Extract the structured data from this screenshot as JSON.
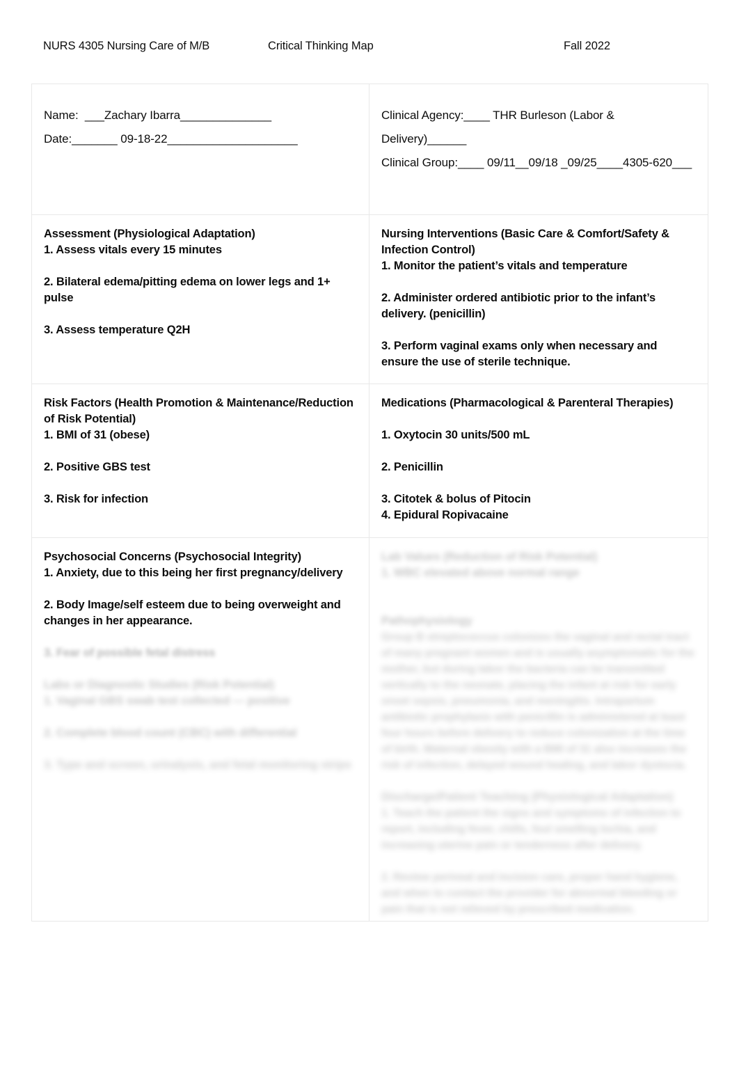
{
  "document": {
    "header": {
      "course": "NURS 4305 Nursing Care of M/B",
      "title": "Critical Thinking Map",
      "term": "Fall 2022"
    }
  },
  "identity": {
    "name_line": "Name:  ___Zachary Ibarra______________",
    "date_line": "Date:_______ 09-18-22____________________",
    "clinical_agency_line": "Clinical Agency:____ THR Burleson (Labor & Delivery)______",
    "clinical_group_line": "Clinical Group:____ 09/11__09/18 _09/25____4305-620___"
  },
  "sections": {
    "assessment": {
      "heading": "Assessment (Physiological Adaptation)",
      "items": [
        "1. Assess vitals every 15 minutes",
        "2. Bilateral edema/pitting edema on lower legs and 1+ pulse",
        "3. Assess temperature Q2H"
      ]
    },
    "nursing_interventions": {
      "heading": "Nursing Interventions (Basic Care & Comfort/Safety & Infection Control)",
      "items": [
        "1. Monitor the patient’s vitals and temperature",
        "2. Administer ordered antibiotic prior to the infant’s delivery. (penicillin)",
        "3. Perform vaginal exams only when necessary and ensure the use of sterile technique."
      ]
    },
    "risk_factors": {
      "heading": "Risk Factors (Health Promotion & Maintenance/Reduction of Risk Potential)",
      "items": [
        "1. BMI of 31 (obese)",
        "2. Positive GBS test",
        "3. Risk for infection"
      ]
    },
    "medications": {
      "heading": "Medications (Pharmacological & Parenteral Therapies)",
      "items": [
        "1. Oxytocin 30 units/500 mL",
        "2. Penicillin",
        "3. Citotek & bolus of Pitocin",
        "4. Epidural Ropivacaine"
      ]
    },
    "psychosocial": {
      "heading": "Psychosocial Concerns (Psychosocial Integrity)",
      "items": [
        "1. Anxiety, due to this being her first pregnancy/delivery",
        "2. Body Image/self esteem due to being overweight and changes in her appearance.",
        "3. Fear of possible fetal distress"
      ]
    },
    "labs_diagnostics": {
      "heading": "Labs or Diagnostic Studies (Risk Potential)",
      "items": [
        "1. Vaginal GBS swab test collected — positive",
        "2. Complete blood count (CBC) with differential",
        "3. Type and screen, urinalysis, and fetal monitoring strips"
      ]
    },
    "lab_right": {
      "heading": "Lab Values (Reduction of Risk Potential)",
      "items": [
        "1. WBC elevated above normal range"
      ]
    },
    "pathophysiology": {
      "heading": "Pathophysiology",
      "body": "Group B streptococcus colonizes the vaginal and rectal tract of many pregnant women and is usually asymptomatic for the mother, but during labor the bacteria can be transmitted vertically to the neonate, placing the infant at risk for early onset sepsis, pneumonia, and meningitis. Intrapartum antibiotic prophylaxis with penicillin is administered at least four hours before delivery to reduce colonization at the time of birth. Maternal obesity with a BMI of 31 also increases the risk of infection, delayed wound healing, and labor dystocia."
    },
    "patient_teaching": {
      "heading": "Discharge/Patient Teaching (Physiological Adaptation)",
      "items": [
        "1. Teach the patient the signs and symptoms of infection to report, including fever, chills, foul smelling lochia, and increasing uterine pain or tenderness after delivery.",
        "2. Review perineal and incision care, proper hand hygiene, and when to contact the provider for abnormal bleeding or pain that is not relieved by prescribed medication."
      ]
    }
  }
}
